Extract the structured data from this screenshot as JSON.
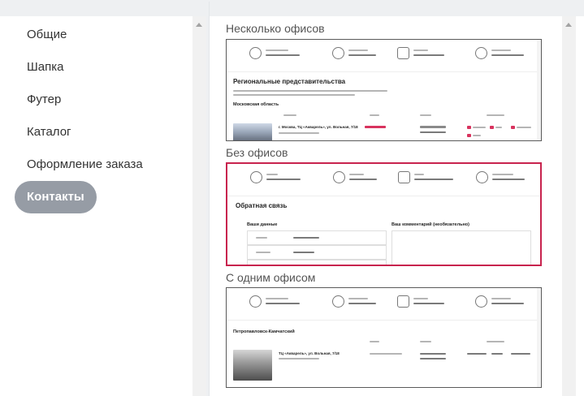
{
  "menu": {
    "items": [
      {
        "label": "Общие",
        "active": false
      },
      {
        "label": "Шапка",
        "active": false
      },
      {
        "label": "Футер",
        "active": false
      },
      {
        "label": "Каталог",
        "active": false
      },
      {
        "label": "Оформление заказа",
        "active": false
      },
      {
        "label": "Контакты",
        "active": true
      }
    ]
  },
  "preview": {
    "sections": [
      {
        "title": "Несколько офисов",
        "selected": false,
        "heading": "Региональные представительства",
        "subheading": "Московская область",
        "office_name": "г. Москва, ТЦ «Акварель», ул. Вольная, 7/18"
      },
      {
        "title": "Без офисов",
        "selected": true,
        "heading": "Обратная связь",
        "your_data_label": "Ваши данные",
        "comment_label": "Ваш комментарий (необязательно)"
      },
      {
        "title": "С одним офисом",
        "selected": false,
        "city": "Петропавловск-Камчатский",
        "office_name": "ТЦ «Акварель», ул. Вольная, 7/18"
      }
    ]
  },
  "colors": {
    "accent": "#c8234e",
    "active_menu": "#969ca5",
    "marker_red": "#d8335e"
  }
}
